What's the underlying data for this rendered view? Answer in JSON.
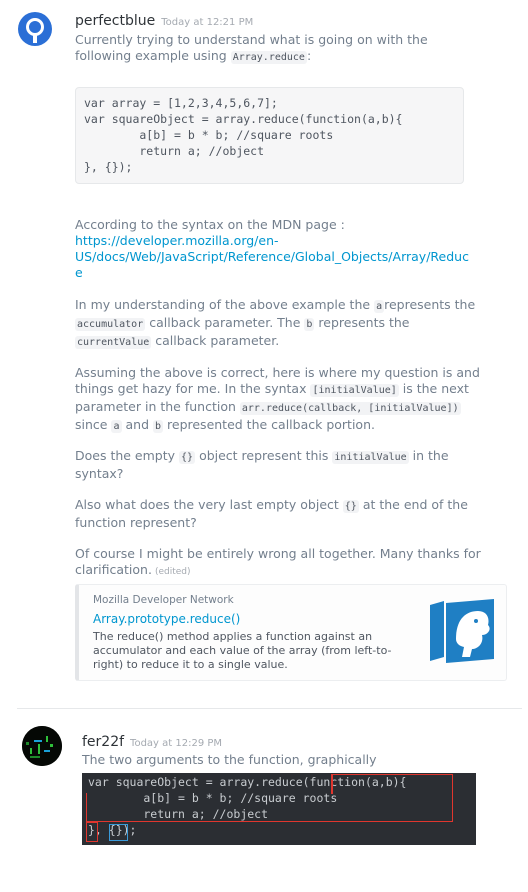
{
  "messages": [
    {
      "username": "perfectblue",
      "timestamp": "Today at 12:21 PM",
      "intro_1": "Currently trying to understand what is going on with the",
      "intro_2": "following example using",
      "intro_code": "Array.reduce",
      "intro_colon": ":",
      "code_lines": [
        "var array = [1,2,3,4,5,6,7];",
        "var squareObject = array.reduce(function(a,b){",
        "        a[b] = b * b; //square roots",
        "        return a; //object",
        "}, {});"
      ],
      "mdn_line": "According to the syntax on the MDN page :",
      "link_1": "https://developer.mozilla.org/en-",
      "link_2": "US/docs/Web/JavaScript/Reference/Global_Objects/Array/Reduc",
      "link_3": "e",
      "p1": {
        "t1": "In my understanding of the above example the",
        "c1": "a",
        "t2": "represents the",
        "c2": "accumulator",
        "t3": "callback parameter. The",
        "c3": "b",
        "t4": "represents the",
        "c4": "currentValue",
        "t5": "callback parameter."
      },
      "p2": {
        "l1": "Assuming the above is correct, here is where my question is and",
        "l2a": "things get hazy for me. In the syntax",
        "c1": "[initialValue]",
        "l2b": "is the next",
        "l3a": "parameter in the function",
        "c2": "arr.reduce(callback, [initialValue])",
        "l4a": "since",
        "c3": "a",
        "l4b": "and",
        "c4": "b",
        "l4c": "represented the callback portion."
      },
      "p3": {
        "a": "Does the empty",
        "c1": "{}",
        "b": "object represent this",
        "c2": "initialValue",
        "c": "in the",
        "d": "syntax?"
      },
      "p4": {
        "a": "Also what does the very last empty object",
        "c1": "{}",
        "b": "at the end of the",
        "c": "function represent?"
      },
      "p5": {
        "a": "Of course I might be entirely wrong all together. Many thanks for",
        "b": "clarification.",
        "edited": "(edited)"
      },
      "embed": {
        "provider": "Mozilla Developer Network",
        "title": "Array.prototype.reduce()",
        "desc_1": "The reduce() method applies a function against an",
        "desc_2": "accumulator and each value of the array (from left-to-",
        "desc_3": "right) to reduce it to a single value."
      }
    },
    {
      "username": "fer22f",
      "timestamp": "Today at 12:29 PM",
      "text": "The two arguments to the function, graphically",
      "code_lines": [
        "var squareObject = array.reduce(function(a,b){",
        "        a[b] = b * b; //square roots",
        "        return a; //object",
        "}, {});"
      ]
    }
  ],
  "colors": {
    "link": "#0096cf",
    "avatar1": "#2b6fd6",
    "annotation_red": "#e0362e",
    "annotation_blue": "#3a9ad9"
  }
}
